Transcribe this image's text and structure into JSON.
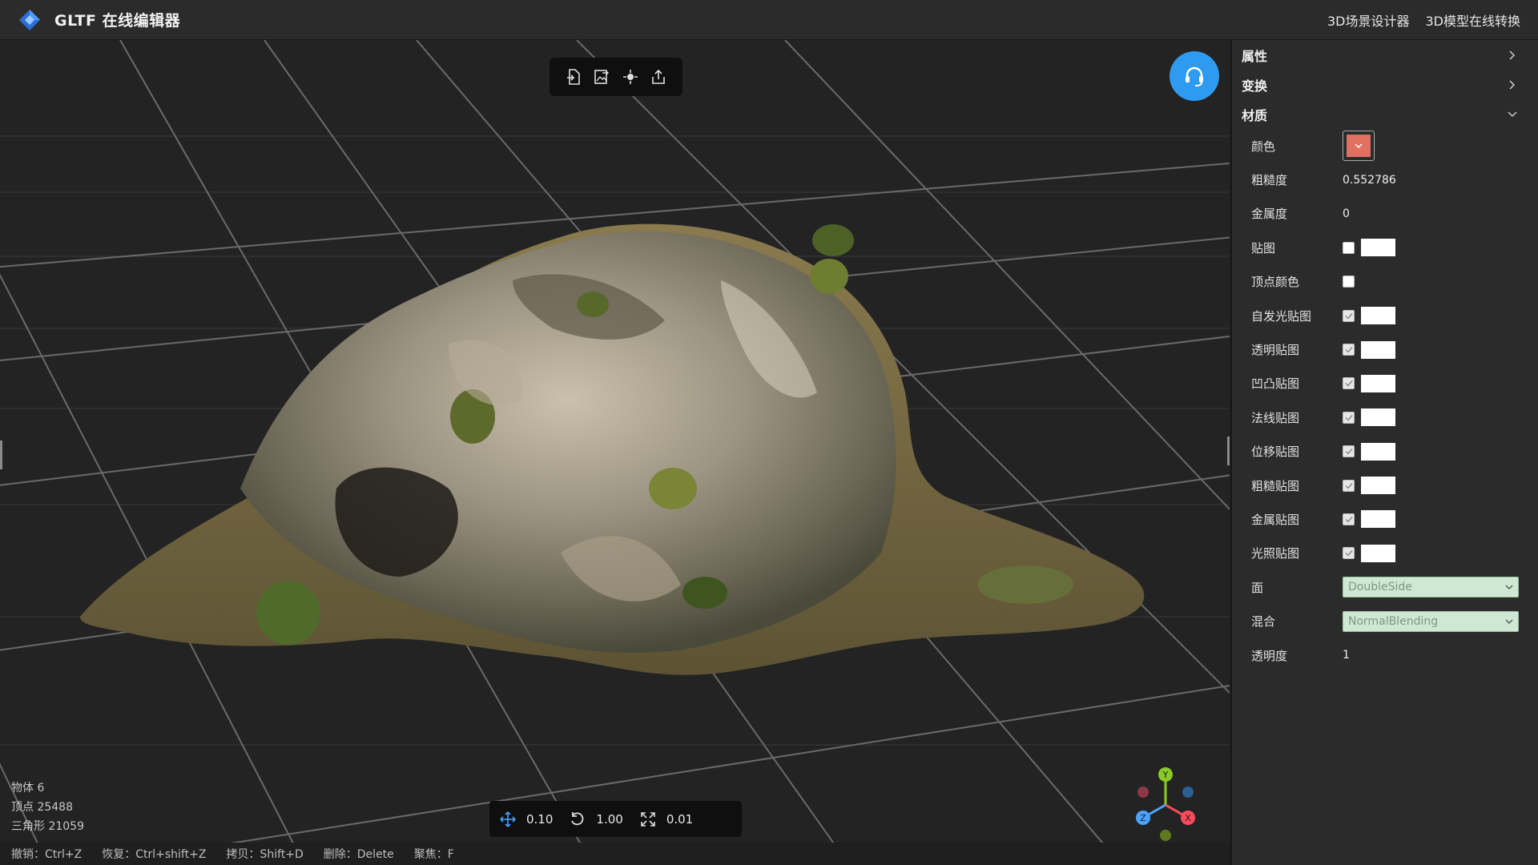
{
  "app": {
    "title": "GLTF 在线编辑器",
    "nav": [
      "3D场景设计器",
      "3D模型在线转换"
    ]
  },
  "toolbar": {
    "tools": [
      "import-icon",
      "image-export-icon",
      "light-icon",
      "export-icon"
    ]
  },
  "stats": {
    "objects": "物体 6",
    "vertices": "顶点 25488",
    "triangles": "三角形 21059"
  },
  "transform": {
    "translate": "0.10",
    "rotate": "1.00",
    "scale": "0.01"
  },
  "hints": [
    "撤销：Ctrl+Z",
    "恢复：Ctrl+shift+Z",
    "拷贝：Shift+D",
    "删除：Delete",
    "聚焦：F"
  ],
  "gizmo": {
    "y": "Y",
    "x": "X",
    "z": "Z"
  },
  "panel": {
    "sections": [
      "属性",
      "变换",
      "材质"
    ],
    "material": {
      "color_label": "颜色",
      "color": "#e07060",
      "roughness_label": "粗糙度",
      "roughness": "0.552786",
      "metalness_label": "金属度",
      "metalness": "0",
      "maps": [
        {
          "label": "贴图",
          "checked": false,
          "tex": true
        },
        {
          "label": "顶点颜色",
          "checked": false,
          "tex": false
        },
        {
          "label": "自发光贴图",
          "checked": true,
          "tex": true
        },
        {
          "label": "透明贴图",
          "checked": true,
          "tex": true
        },
        {
          "label": "凹凸贴图",
          "checked": true,
          "tex": true
        },
        {
          "label": "法线贴图",
          "checked": true,
          "tex": true
        },
        {
          "label": "位移贴图",
          "checked": true,
          "tex": true
        },
        {
          "label": "粗糙贴图",
          "checked": true,
          "tex": true
        },
        {
          "label": "金属贴图",
          "checked": true,
          "tex": true
        },
        {
          "label": "光照贴图",
          "checked": true,
          "tex": true
        }
      ],
      "side_label": "面",
      "side": "DoubleSide",
      "blend_label": "混合",
      "blend": "NormalBlending",
      "opacity_label": "透明度",
      "opacity": "1"
    }
  }
}
